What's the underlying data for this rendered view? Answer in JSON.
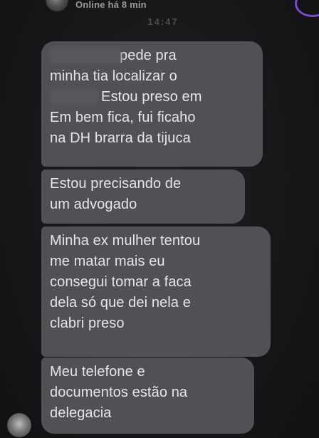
{
  "header": {
    "status": "Online há 8 min"
  },
  "chat": {
    "timestamp": "14:47",
    "messages": [
      {
        "lines": [
          "pede pra",
          "minha tia localizar o",
          "Estou preso em",
          "Em bem fica, fui ficaho",
          "na DH brarra da tijuca"
        ]
      },
      {
        "lines": [
          "Estou precisando de",
          "um advogado"
        ]
      },
      {
        "lines": [
          "Minha ex mulher tentou",
          "me matar mais eu",
          "consegui tomar a faca",
          "dela só que dei nela e",
          "clabri preso"
        ]
      },
      {
        "lines": [
          "Meu telefone e",
          "documentos estão na",
          "delegacia"
        ]
      }
    ]
  },
  "icons": {
    "header_avatar": "contact-avatar-icon",
    "menu": "menu-icon",
    "sender_avatar": "sender-avatar-icon"
  },
  "colors": {
    "background": "#151617",
    "bubble": "#505154",
    "bubble_text": "#e6e6e6",
    "accent": "#7a4ad0"
  }
}
